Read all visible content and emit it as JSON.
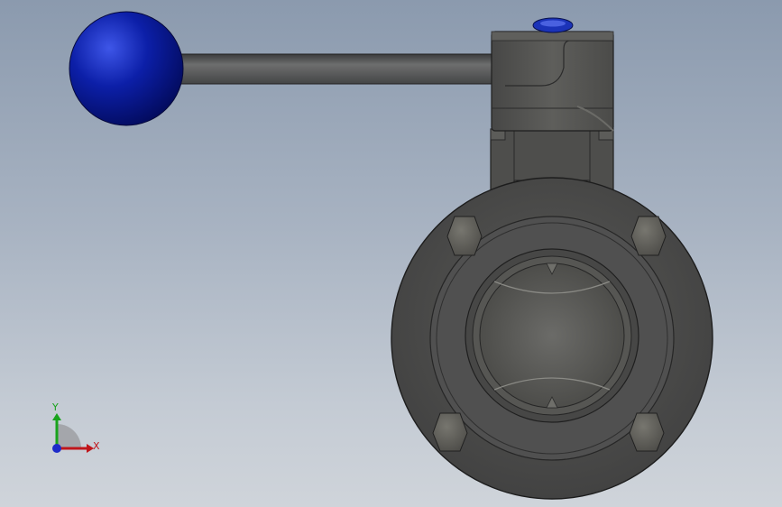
{
  "triad": {
    "x_label": "X",
    "y_label": "Y",
    "x_color": "#c0161b",
    "y_color": "#19a31c",
    "z_color": "#1d2bc9"
  },
  "model": {
    "handle_ball_color": "#0a1a9c",
    "body_color": "#4a4a48",
    "stem_cap_color": "#1b33b8"
  }
}
